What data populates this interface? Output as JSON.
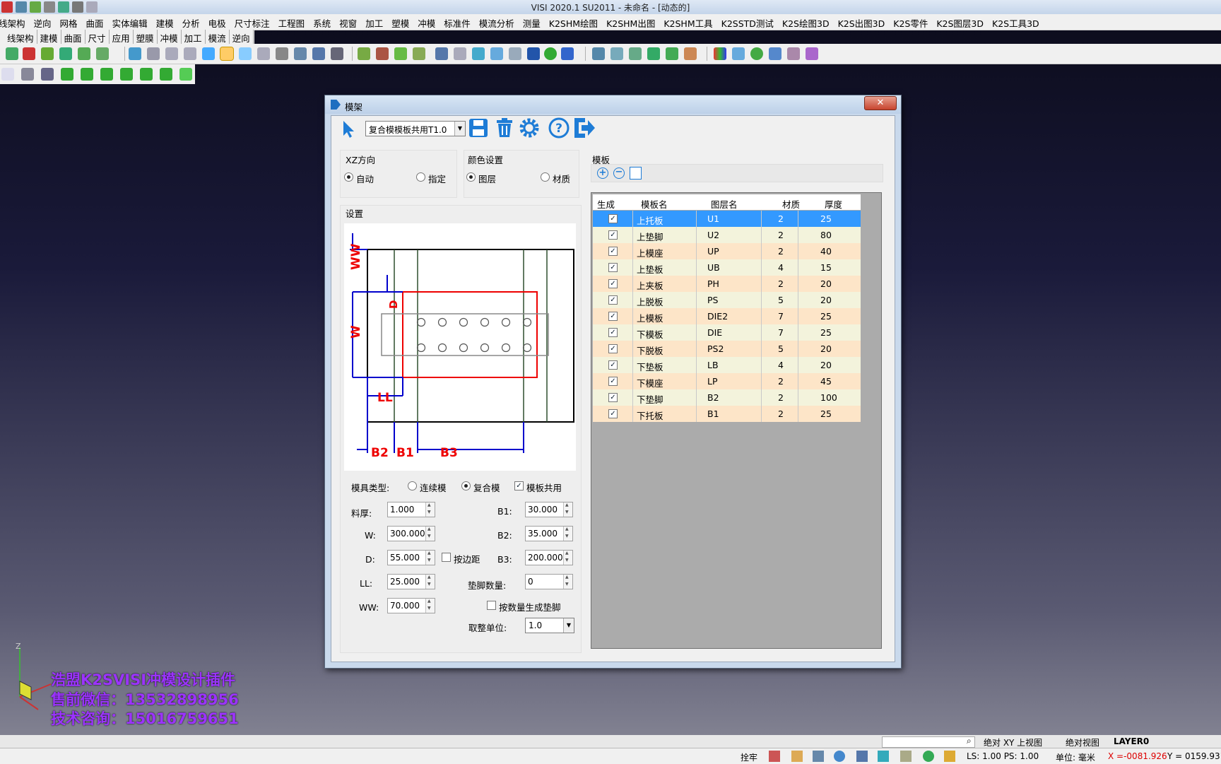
{
  "window": {
    "title": "VISI 2020.1 SU2011 - 未命名 - [动态的]"
  },
  "menu": [
    "线架构",
    "逆向",
    "网格",
    "曲面",
    "实体编辑",
    "建模",
    "分析",
    "电极",
    "尺寸标注",
    "工程图",
    "系统",
    "视窗",
    "加工",
    "塑模",
    "冲模",
    "标准件",
    "模流分析",
    "测量",
    "K2SHM绘图",
    "K2SHM出图",
    "K2SHM工具",
    "K2SSTD测试",
    "K2S绘图3D",
    "K2S出图3D",
    "K2S零件",
    "K2S图层3D",
    "K2S工具3D"
  ],
  "tabs": [
    "线架构",
    "建模",
    "曲面",
    "尺寸",
    "应用",
    "塑膜",
    "冲模",
    "加工",
    "模流",
    "逆向"
  ],
  "dialog": {
    "title": "模架",
    "template_select": "复合模模板共用T1.0",
    "xz": {
      "title": "XZ方向",
      "opt1": "自动",
      "opt2": "指定"
    },
    "color": {
      "title": "颜色设置",
      "opt1": "图层",
      "opt2": "材质"
    },
    "settings_title": "设置",
    "plates_title": "模板",
    "diagram_labels": {
      "ww": "WW",
      "w": "W",
      "d": "D",
      "ll": "LL",
      "b2": "B2",
      "b1": "B1",
      "b3": "B3"
    },
    "mold_type": {
      "label": "模具类型:",
      "opt1": "连续模",
      "opt2": "复合模",
      "shared": "模板共用"
    },
    "fields": {
      "thickness_label": "料厚:",
      "thickness": "1.000",
      "w_label": "W:",
      "w": "300.000",
      "d_label": "D:",
      "d": "55.000",
      "by_edge": "按边距",
      "ll_label": "LL:",
      "ll": "25.000",
      "ww_label": "WW:",
      "ww": "70.000",
      "b1_label": "B1:",
      "b1": "30.000",
      "b2_label": "B2:",
      "b2": "35.000",
      "b3_label": "B3:",
      "b3": "200.000",
      "pad_count_label": "垫脚数量:",
      "pad_count": "0",
      "gen_pads": "按数量生成垫脚",
      "round_label": "取整单位:",
      "round": "1.0"
    },
    "table": {
      "headers": [
        "生成",
        "模板名",
        "图层名",
        "材质",
        "厚度"
      ],
      "rows": [
        {
          "name": "上托板",
          "layer": "U1",
          "mat": "2",
          "thk": "25"
        },
        {
          "name": "上垫脚",
          "layer": "U2",
          "mat": "2",
          "thk": "80"
        },
        {
          "name": "上模座",
          "layer": "UP",
          "mat": "2",
          "thk": "40"
        },
        {
          "name": "上垫板",
          "layer": "UB",
          "mat": "4",
          "thk": "15"
        },
        {
          "name": "上夹板",
          "layer": "PH",
          "mat": "2",
          "thk": "20"
        },
        {
          "name": "上脱板",
          "layer": "PS",
          "mat": "5",
          "thk": "20"
        },
        {
          "name": "上模板",
          "layer": "DIE2",
          "mat": "7",
          "thk": "25"
        },
        {
          "name": "下模板",
          "layer": "DIE",
          "mat": "7",
          "thk": "25"
        },
        {
          "name": "下脱板",
          "layer": "PS2",
          "mat": "5",
          "thk": "20"
        },
        {
          "name": "下垫板",
          "layer": "LB",
          "mat": "4",
          "thk": "20"
        },
        {
          "name": "下模座",
          "layer": "LP",
          "mat": "2",
          "thk": "45"
        },
        {
          "name": "下垫脚",
          "layer": "B2",
          "mat": "2",
          "thk": "100"
        },
        {
          "name": "下托板",
          "layer": "B1",
          "mat": "2",
          "thk": "25"
        }
      ]
    }
  },
  "watermark": {
    "line1": "浩盟K2SVISI冲模设计插件",
    "line2": "售前微信：13532898956",
    "line3": "技术咨询：15016759651"
  },
  "status": {
    "view": "绝对 XY 上视图",
    "abs_view": "绝对视图",
    "layer": "LAYER0",
    "snap": "拴牢",
    "ls": "LS: 1.00 PS: 1.00",
    "unit": "单位: 毫米",
    "x": "X =-0081.926",
    "y": "Y = 0159.931"
  }
}
